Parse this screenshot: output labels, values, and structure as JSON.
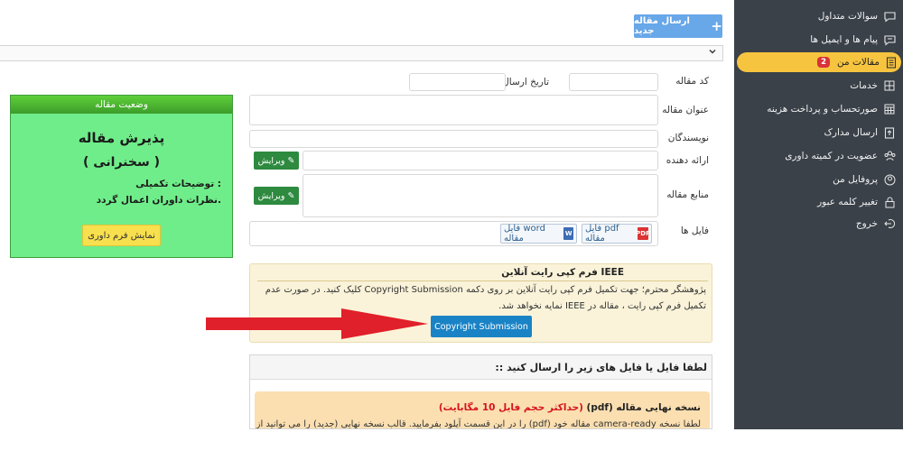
{
  "sidebar": {
    "items": [
      {
        "label": "سوالات متداول",
        "icon": "chat-question-icon"
      },
      {
        "label": "پیام ها و ایمیل ها",
        "icon": "chat-icon"
      },
      {
        "label": "مقالات من",
        "icon": "document-icon",
        "badge": "2",
        "active": true
      },
      {
        "label": "خدمات",
        "icon": "grid-icon"
      },
      {
        "label": "صورتحساب و پرداخت هزینه",
        "icon": "calculator-icon"
      },
      {
        "label": "ارسال مدارک",
        "icon": "upload-document-icon"
      },
      {
        "label": "عضویت در کمیته داوری",
        "icon": "group-icon"
      },
      {
        "label": "پروفایل من",
        "icon": "user-icon"
      },
      {
        "label": "تغییر کلمه عبور",
        "icon": "lock-icon"
      },
      {
        "label": "خروج",
        "icon": "logout-icon"
      }
    ]
  },
  "toolbar": {
    "new_article_label": "ارسال مقاله جدید"
  },
  "form": {
    "code_label": "کد مقاله",
    "date_label": "تاریخ ارسال",
    "title_label": "عنوان مقاله",
    "authors_label": "نویسندگان",
    "presenter_label": "ارائه دهنده",
    "sources_label": "منابع مقاله",
    "files_label": "فایل ها",
    "edit_label": "ویرایش",
    "file_pdf_label": "فایل pdf مقاله",
    "file_word_label": "فایل word مقاله"
  },
  "status": {
    "header": "وضعیت مقاله",
    "title": "پذیرش مقاله",
    "subtitle": "( سخنرانی )",
    "note_label": "توضیحات تکمیلی :",
    "note_text": "نظرات داوران اعمال گردد.",
    "button": "نمایش فرم داوری"
  },
  "copyright": {
    "title": "فرم کپی رایت آنلاین IEEE",
    "text": "پژوهشگر محترم؛ جهت تکمیل فرم کپی رایت آنلاین بر روی دکمه Copyright Submission کلیک کنید. در صورت عدم تکمیل فرم کپی رایت ، مقاله در IEEE نمایه نخواهد شد.",
    "button": "Copyright Submission"
  },
  "upload": {
    "header": ":: لطفا فایل یا فایل های زیر را ارسال کنید",
    "card_title": "نسخه نهایی مقاله (pdf)",
    "card_title_note": "(حداکثر حجم فایل 10 مگابایت)",
    "card_text": "لطفا نسخه camera-ready مقاله خود (pdf) را در این قسمت آپلود بفرمایید. قالب نسخه نهایی (جدید) را می توانید از"
  },
  "colors": {
    "sidebar_bg": "#3a4149",
    "sidebar_active": "#f7c43f",
    "primary_button": "#68a7e8",
    "copyright_button": "#1a83c6",
    "edit_button": "#2d8a3f",
    "status_bg": "#6fed8a",
    "arrow": "#e0202a"
  }
}
